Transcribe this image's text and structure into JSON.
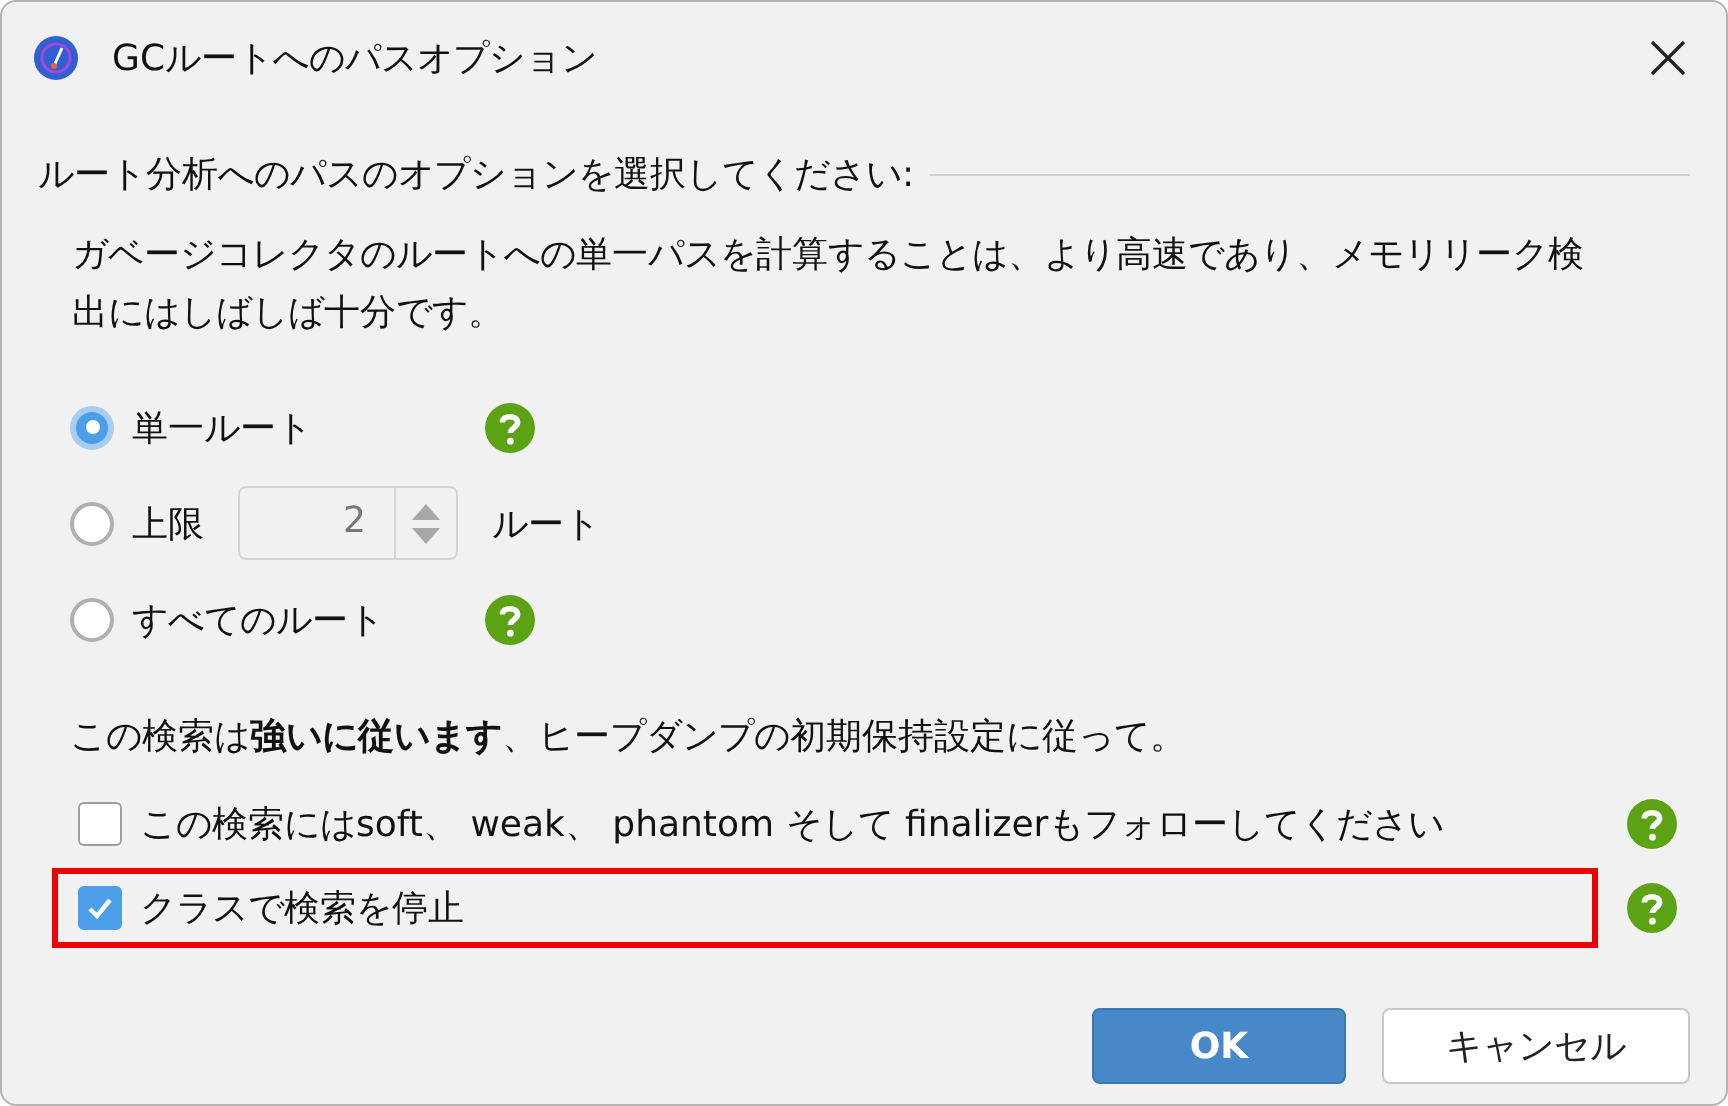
{
  "window": {
    "title": "GCルートへのパスオプション"
  },
  "section_label": "ルート分析へのパスのオプションを選択してください:",
  "description": "ガベージコレクタのルートへの単一パスを計算することは、より高速であり、メモリリーク検出にはしばしば十分です。",
  "radios": [
    {
      "kind": "plain",
      "label": "単一ルート",
      "selected": true,
      "help": true
    },
    {
      "kind": "limit",
      "label": "上限",
      "selected": false,
      "help": false,
      "value": "2",
      "suffix": "ルート"
    },
    {
      "kind": "plain",
      "label": "すべてのルート",
      "selected": false,
      "help": true
    }
  ],
  "note": "この検索は**強いに従います**、ヒープダンプの初期保持設定に従って。",
  "checkboxes": [
    {
      "label": "この検索にはsoft、 weak、 phantom そして finalizerもフォローしてください",
      "checked": false,
      "help": true,
      "highlighted": false
    },
    {
      "label": "クラスで検索を停止",
      "checked": true,
      "help": true,
      "highlighted": true
    }
  ],
  "buttons": [
    {
      "kind": "primary",
      "label": "OK"
    },
    {
      "kind": "secondary",
      "label": "キャンセル"
    }
  ]
}
